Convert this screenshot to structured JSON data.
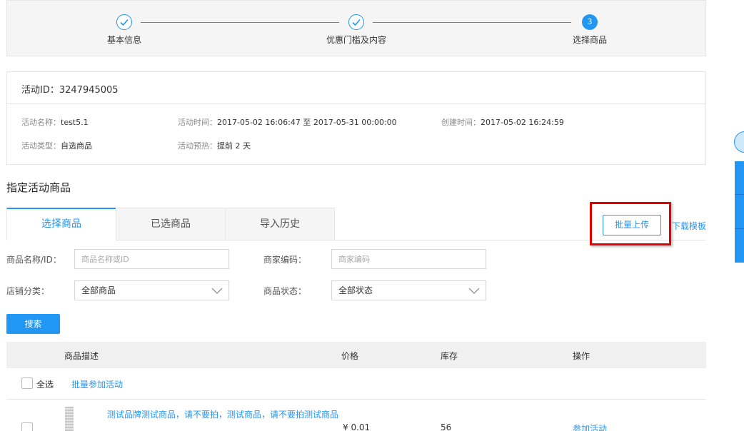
{
  "steps": [
    {
      "label": "基本信息",
      "state": "done",
      "icon": "check-icon"
    },
    {
      "label": "优惠门槛及内容",
      "state": "done",
      "icon": "check-icon"
    },
    {
      "label": "选择商品",
      "state": "active",
      "number": "3"
    }
  ],
  "activity": {
    "id_label": "活动ID：",
    "id_value": "3247945005",
    "name_label": "活动名称：",
    "name_value": "test5.1",
    "time_label": "活动时间：",
    "time_value": "2017-05-02 16:06:47 至 2017-05-31 00:00:00",
    "created_label": "创建时间：",
    "created_value": "2017-05-02 16:24:59",
    "type_label": "活动类型：",
    "type_value": "自选商品",
    "preheat_label": "活动预热：",
    "preheat_value": "提前 2 天"
  },
  "section_title": "指定活动商品",
  "tabs": [
    {
      "label": "选择商品",
      "active": true
    },
    {
      "label": "已选商品",
      "active": false
    },
    {
      "label": "导入历史",
      "active": false
    }
  ],
  "actions": {
    "batch_upload": "批量上传",
    "download_template": "下载模板"
  },
  "filters": {
    "name_label": "商品名称/ID：",
    "name_placeholder": "商品名称或ID",
    "code_label": "商家编码：",
    "code_placeholder": "商家编码",
    "category_label": "店铺分类：",
    "category_value": "全部商品",
    "status_label": "商品状态：",
    "status_value": "全部状态",
    "search_button": "搜索"
  },
  "table": {
    "headers": {
      "desc": "商品描述",
      "price": "价格",
      "stock": "库存",
      "action": "操作"
    },
    "select_all": "全选",
    "batch_join": "批量参加活动",
    "rows": [
      {
        "name": "测试品牌测试商品，请不要拍，测试商品，请不要拍测试商品",
        "price": "¥ 0.01",
        "stock": "56",
        "action": "参加活动"
      }
    ]
  },
  "colors": {
    "accent": "#2196f3",
    "highlight": "#e60000"
  }
}
